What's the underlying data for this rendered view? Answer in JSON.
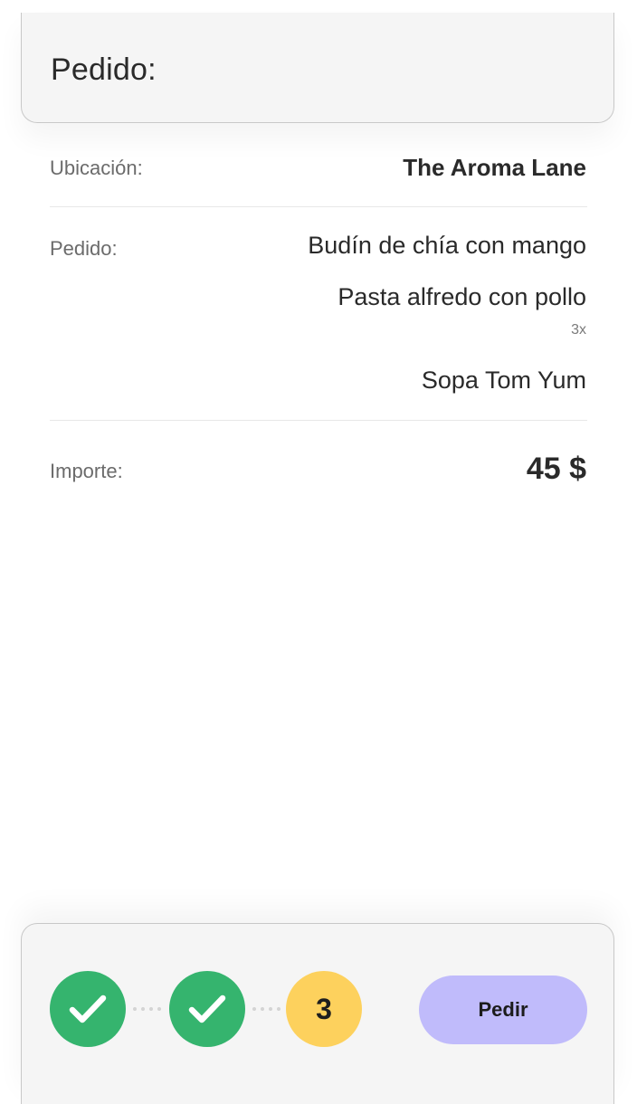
{
  "header": {
    "title": "Pedido:"
  },
  "location": {
    "label": "Ubicación:",
    "value": "The Aroma Lane"
  },
  "order": {
    "label": "Pedido:",
    "items": [
      {
        "name": "Budín de chía con mango",
        "quantity": ""
      },
      {
        "name": "Pasta alfredo con pollo",
        "quantity": "3x"
      },
      {
        "name": "Sopa Tom Yum",
        "quantity": ""
      }
    ]
  },
  "amount": {
    "label": "Importe:",
    "value": "45 $"
  },
  "footer": {
    "steps": [
      {
        "state": "completed",
        "icon": "check-icon"
      },
      {
        "state": "completed",
        "icon": "check-icon"
      },
      {
        "state": "current",
        "number": "3"
      }
    ],
    "order_button_label": "Pedir"
  },
  "colors": {
    "step_completed": "#35b46e",
    "step_current": "#fdd15d",
    "button": "#c0bbfb",
    "card_background": "#f5f5f5"
  }
}
